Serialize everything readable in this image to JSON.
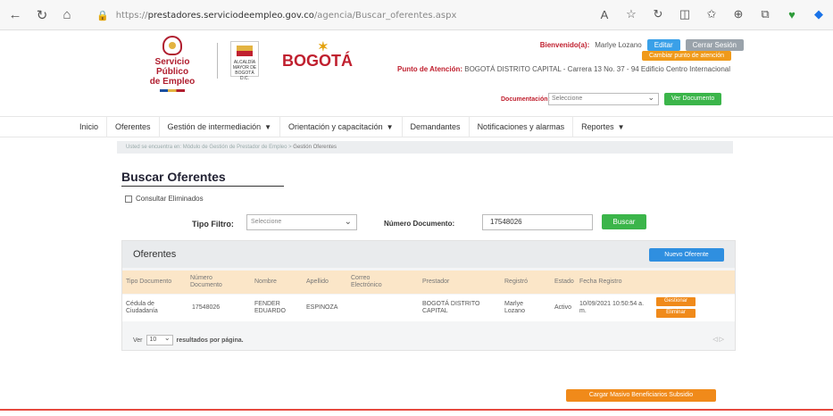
{
  "browser": {
    "url_prefix": "https://",
    "url_host": "prestadores.serviciodeempleo.gov.co",
    "url_path": "/agencia/Buscar_oferentes.aspx"
  },
  "brand": {
    "spe_line1": "Servicio Público",
    "spe_line2": "de Empleo",
    "bogota_text": "BOGOTÁ",
    "bogota_small": "ALCALDÍA MAYOR DE BOGOTÁ D.C."
  },
  "header": {
    "welcome": "Bienvenido(a):",
    "user_name": "Marlye Lozano",
    "edit_label": "Editar",
    "logout_label": "Cerrar Sesión",
    "change_point_label": "Cambiar punto de atención",
    "punto_label": "Punto de Atención:",
    "punto_value": "BOGOTÁ DISTRITO CAPITAL - Carrera 13 No. 37 - 94 Edificio Centro Internacional",
    "doc_label": "Documentación:",
    "doc_select_value": "Seleccione",
    "doc_button": "Ver Documento"
  },
  "nav": {
    "items": [
      "Inicio",
      "Oferentes",
      "Gestión de intermediación",
      "Orientación y capacitación",
      "Demandantes",
      "Notificaciones y alarmas",
      "Reportes"
    ]
  },
  "breadcrumb": {
    "prefix": "Usted se encuentra en:",
    "path": "Módulo de Gestión de Prestador de Empleo > ",
    "current": "Gestión Oferentes"
  },
  "search": {
    "title": "Buscar Oferentes",
    "deleted_label": "Consultar Eliminados",
    "filter_label": "Tipo Filtro:",
    "filter_value": "Seleccione",
    "doc_number_label": "Número Documento:",
    "doc_number_value": "17548026",
    "search_button": "Buscar"
  },
  "results": {
    "title": "Oferentes",
    "new_button": "Nuevo Oferente",
    "columns": [
      "Tipo Documento",
      "Número Documento",
      "Nombre",
      "Apellido",
      "Correo Electrónico",
      "Prestador",
      "Registró",
      "Estado",
      "Fecha Registro"
    ],
    "row": {
      "tipo": "Cédula de Ciudadanía",
      "numero": "17548026",
      "nombre": "FENDER EDUARDO",
      "apellido": "ESPINOZA",
      "correo": "",
      "prestador": "BOGOTÁ DISTRITO CAPITAL",
      "registro": "Marlye Lozano",
      "estado": "Activo",
      "fecha": "10/09/2021 10:50:54 a. m.",
      "edit": "Gestionar",
      "delete": "Eliminar"
    },
    "footer_prefix": "Ver",
    "page_size": "10",
    "footer_suffix": "resultados por página.",
    "pager": "◁ ▷"
  },
  "bottom_button": "Cargar Masivo Beneficiarios Subsidio",
  "colors": {
    "brand_red": "#c0202f",
    "accent_orange": "#f08a1a",
    "accent_green": "#3bb54a",
    "accent_blue": "#2f8fe0"
  }
}
